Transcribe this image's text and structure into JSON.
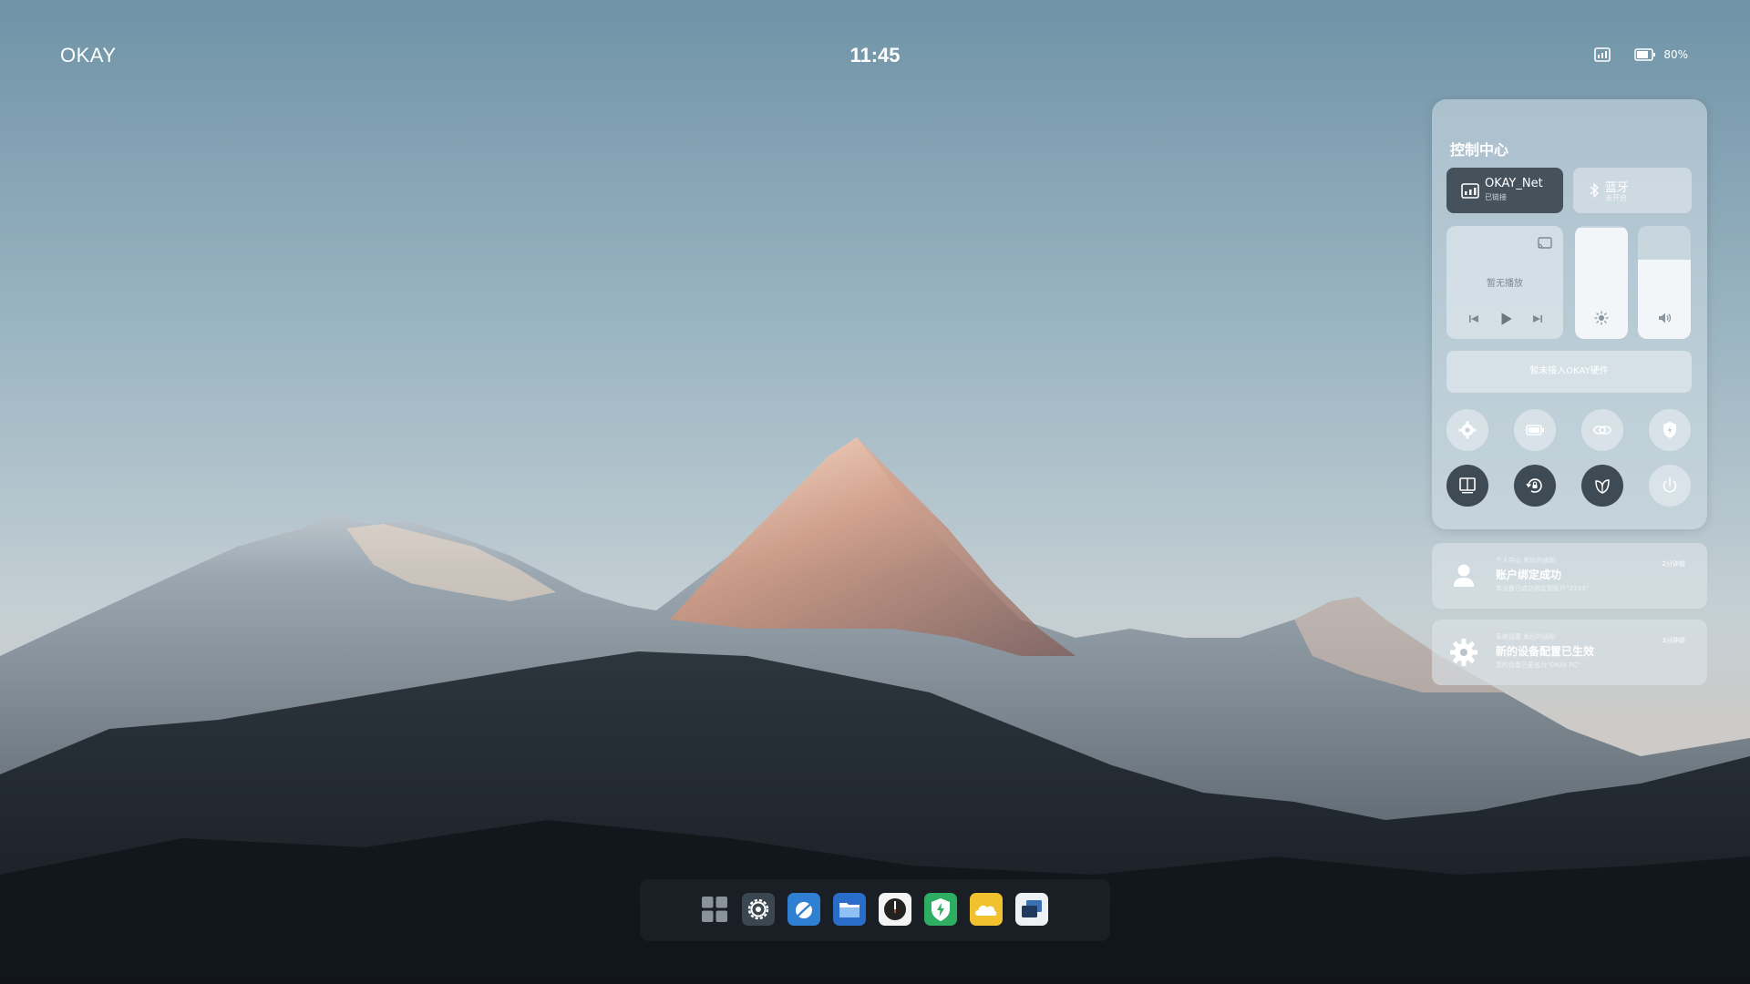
{
  "status_bar": {
    "brand": "OKAY",
    "time": "11:45",
    "battery_text": "80%",
    "battery_level": 0.8,
    "icons": [
      "network-icon",
      "battery-icon"
    ]
  },
  "control_center": {
    "title": "控制中心",
    "network_tile": {
      "name": "OKAY_Net",
      "status": "已链接",
      "icon": "network-icon"
    },
    "bluetooth_tile": {
      "name": "蓝牙",
      "status": "未开启",
      "icon": "bluetooth-icon"
    },
    "media": {
      "now_playing": "暂无播放",
      "icons": [
        "cast-icon",
        "previous-icon",
        "play-icon",
        "next-icon"
      ]
    },
    "brightness": {
      "level": 0.98,
      "icon": "sun-icon"
    },
    "volume": {
      "level": 0.7,
      "icon": "volume-icon"
    },
    "hardware_bar": "暂未接入OKAY硬件",
    "toggles_row1": [
      "gear-icon",
      "battery-icon",
      "link-icon",
      "shield-icon"
    ],
    "toggles_row2": [
      "ebook-icon",
      "rotation-lock-icon",
      "leaf-icon",
      "power-icon"
    ]
  },
  "notifications": [
    {
      "icon": "user-icon",
      "source": "个人中心 发出的通知",
      "title": "账户绑定成功",
      "body": "本设备已成功绑定到账户“2333”",
      "time": "2分钟前"
    },
    {
      "icon": "gear-icon",
      "source": "系统设置 发出的通知",
      "title": "新的设备配置已生效",
      "body": "您的设备已更名为“OKAY PC”",
      "time": "3分钟前"
    }
  ],
  "dock": {
    "apps": [
      "launcher-icon",
      "settings-icon",
      "browser-icon",
      "files-icon",
      "clock-icon",
      "security-icon",
      "weather-icon",
      "multitask-icon"
    ]
  }
}
